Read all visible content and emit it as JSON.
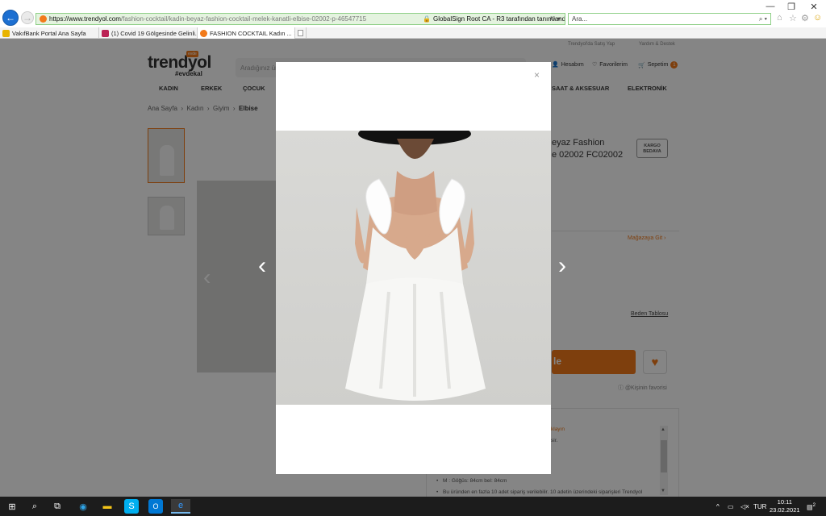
{
  "browser": {
    "url_domain": "https://www.trendyol.com",
    "url_path": "/fashion-cocktail/kadin-beyaz-fashion-cocktail-melek-kanatli-elbise-02002-p-46547715",
    "cert_text": "GlobalSign Root CA - R3 tarafından tanımlandı",
    "search_placeholder": "Ara...",
    "tabs": [
      {
        "label": "VakıfBank Portal Ana Sayfa"
      },
      {
        "label": "(1) Covid 19 Gölgesinde Gelinli..."
      },
      {
        "label": "FASHION COCKTAIL Kadın ..."
      }
    ]
  },
  "site": {
    "top_links": [
      "Trendyol'da Satış Yap",
      "Yardım & Destek"
    ],
    "logo_text": "trendyol",
    "logo_sub": "#evdekal",
    "logo_badge": "evde",
    "search_placeholder": "Aradığınız ür...",
    "account": "Hesabım",
    "favorites": "Favorilerim",
    "cart": "Sepetim",
    "cart_count": "1",
    "categories": [
      "KADIN",
      "ERKEK",
      "ÇOCUK",
      "SAAT & AKSESUAR",
      "ELEKTRONİK"
    ],
    "breadcrumb": [
      "Ana Sayfa",
      "Kadın",
      "Giyim",
      "Elbise"
    ],
    "product_title_line1": "eyaz Fashion",
    "product_title_line2": "e 02002 FC02002",
    "kargo_line1": "KARGO",
    "kargo_line2": "BEDAVA",
    "store_link": "Mağazaya Git",
    "size_table": "Beden Tablosu",
    "add_to_cart": "le",
    "fav_note": "ⓘ @Kişinin favorisi",
    "desc_link": "klayın",
    "desc_frag": "sir.",
    "desc_items": [
      "M : Göğüs: 84cm bel: 84cm",
      "Bu üründen en fazla 10 adet sipariş verilebilir. 10 adetin üzerindeki siparişleri Trendyol"
    ]
  },
  "modal": {
    "close": "×",
    "prev_arrow": "‹",
    "next_arrow": "›"
  },
  "taskbar": {
    "lang": "TUR",
    "time": "10:11",
    "date": "23.02.2021",
    "notif_count": "2"
  },
  "colors": {
    "accent": "#f27a1a",
    "address_bg": "#e4f3df",
    "taskbar": "#1c1c1c"
  }
}
